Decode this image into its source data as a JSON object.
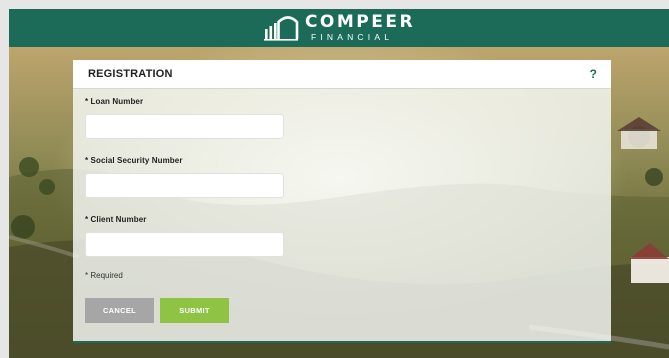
{
  "brand": {
    "name_main": "COMPEER",
    "name_sub": "FINANCIAL",
    "header_color": "#1c6b58"
  },
  "panel": {
    "title": "REGISTRATION",
    "help_label": "?"
  },
  "form": {
    "fields": [
      {
        "label": "* Loan Number",
        "value": "",
        "placeholder": ""
      },
      {
        "label": "* Social Security Number",
        "value": "",
        "placeholder": ""
      },
      {
        "label": "* Client Number",
        "value": "",
        "placeholder": ""
      }
    ],
    "required_note": "* Required"
  },
  "buttons": {
    "cancel_label": "CANCEL",
    "submit_label": "SUBMIT",
    "cancel_color": "#a6a6a6",
    "submit_color": "#8fc344"
  },
  "icons": {
    "logo": "building-arch-icon"
  }
}
